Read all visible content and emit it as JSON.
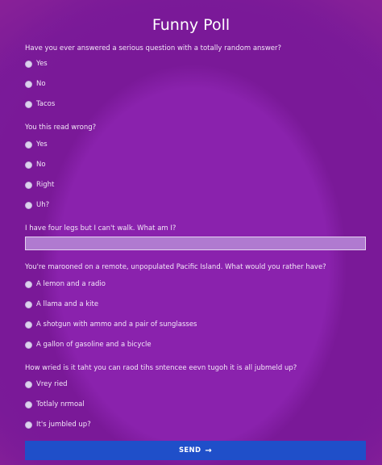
{
  "title": "Funny Poll",
  "questions": [
    {
      "label": "Have you ever answered a serious question with a totally random answer?",
      "options": [
        "Yes",
        "No",
        "Tacos"
      ]
    },
    {
      "label": "You this read wrong?",
      "options": [
        "Yes",
        "No",
        "Right",
        "Uh?"
      ]
    },
    {
      "label": "I have four legs but I can't walk. What am I?",
      "input_value": "",
      "input_placeholder": ""
    },
    {
      "label": "You're marooned on a remote, unpopulated Pacific Island. What would you rather have?",
      "options": [
        "A lemon and a radio",
        "A llama and a kite",
        "A shotgun with ammo and a pair of sunglasses",
        "A gallon of gasoline and a bicycle"
      ]
    },
    {
      "label": "How wried is it taht you can raod tihs sntencee eevn tugoh it is all jubmeld up?",
      "options": [
        "Vrey ried",
        "Totlaly nrmoal",
        "It's jumbled up?"
      ]
    }
  ],
  "submit": {
    "label": "SEND",
    "icon": "arrow-right-icon"
  },
  "colors": {
    "background": "#7d1a9c",
    "button": "#1f4fc9",
    "input": "#b07ad0"
  }
}
